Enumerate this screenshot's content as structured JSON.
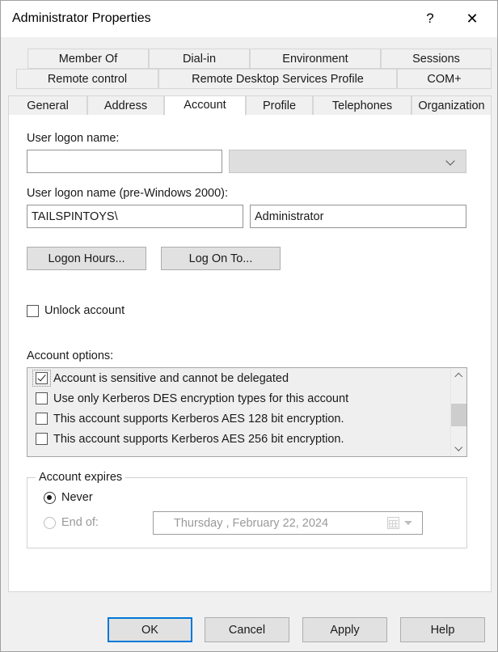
{
  "window": {
    "title": "Administrator Properties",
    "help_button": "?",
    "close_button": "✕"
  },
  "tabs": {
    "row1": [
      {
        "label": "Member Of",
        "active": false
      },
      {
        "label": "Dial-in",
        "active": false
      },
      {
        "label": "Environment",
        "active": false
      },
      {
        "label": "Sessions",
        "active": false
      }
    ],
    "row2": [
      {
        "label": "Remote control",
        "active": false
      },
      {
        "label": "Remote Desktop Services Profile",
        "active": false
      },
      {
        "label": "COM+",
        "active": false
      }
    ],
    "row3": [
      {
        "label": "General",
        "active": false
      },
      {
        "label": "Address",
        "active": false
      },
      {
        "label": "Account",
        "active": true
      },
      {
        "label": "Profile",
        "active": false
      },
      {
        "label": "Telephones",
        "active": false
      },
      {
        "label": "Organization",
        "active": false
      }
    ]
  },
  "account": {
    "logon_name_label": "User logon name:",
    "logon_name_value": "",
    "logon_name_placeholder": "",
    "upn_suffix_value": "",
    "pre2000_label": "User logon name (pre-Windows 2000):",
    "pre2000_domain": "TAILSPINTOYS\\",
    "pre2000_user": "Administrator",
    "logon_hours_button": "Logon Hours...",
    "log_on_to_button": "Log On To...",
    "unlock_label": "Unlock account",
    "unlock_checked": false,
    "options_label": "Account options:",
    "options": [
      {
        "label": "Account is sensitive and cannot be delegated",
        "checked": true,
        "focused": true
      },
      {
        "label": "Use only Kerberos DES encryption types for this account",
        "checked": false,
        "focused": false
      },
      {
        "label": "This account supports Kerberos AES 128 bit encryption.",
        "checked": false,
        "focused": false
      },
      {
        "label": "This account supports Kerberos AES 256 bit encryption.",
        "checked": false,
        "focused": false
      }
    ],
    "expires": {
      "group_title": "Account expires",
      "never_label": "Never",
      "never_selected": true,
      "end_of_label": "End of:",
      "end_of_selected": false,
      "end_of_enabled": false,
      "date_value": "Thursday   ,   February  22, 2024"
    }
  },
  "footer": {
    "ok": "OK",
    "cancel": "Cancel",
    "apply": "Apply",
    "help": "Help"
  },
  "colors": {
    "accent": "#0078d7",
    "dialog_bg": "#f0f0f0",
    "page_bg": "#ffffff",
    "close_hover": "#e81123"
  }
}
